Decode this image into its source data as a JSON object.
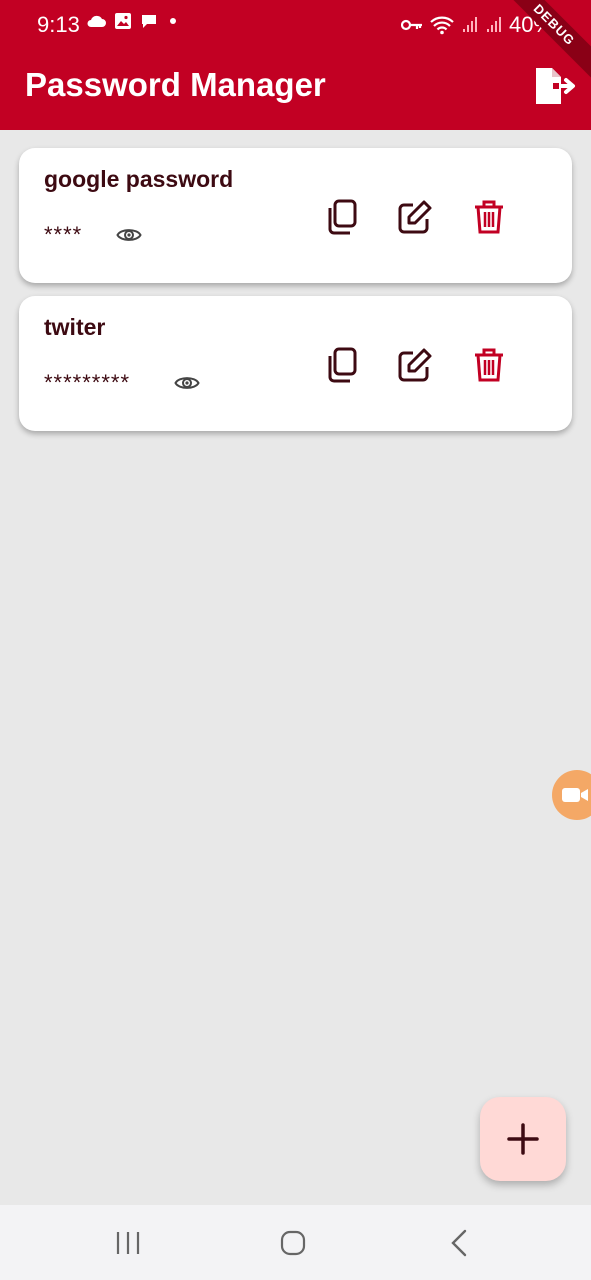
{
  "status_bar": {
    "time": "9:13",
    "battery": "40%",
    "debug_label": "DEBUG"
  },
  "app_bar": {
    "title": "Password Manager",
    "logout_icon": "logout-icon"
  },
  "entries": [
    {
      "title": "google password",
      "masked_password": "****"
    },
    {
      "title": "twiter",
      "masked_password": "*********"
    }
  ],
  "icons": {
    "copy": "copy-icon",
    "edit": "edit-icon",
    "delete": "trash-icon",
    "reveal": "eye-icon",
    "add": "plus-icon"
  },
  "colors": {
    "brand": "#c20023",
    "text_dark": "#3d0a12",
    "delete": "#c20023",
    "fab_bg": "#ffd9d6",
    "background": "#e8e8e8"
  }
}
